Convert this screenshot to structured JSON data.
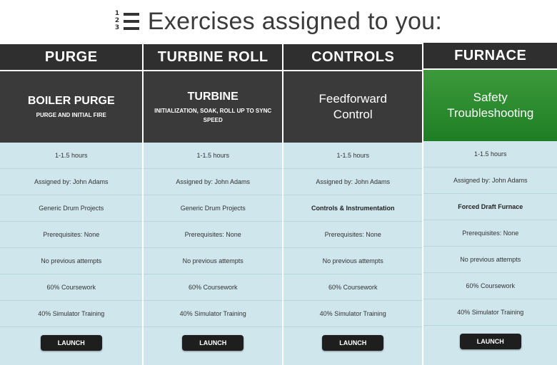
{
  "header": {
    "title": "Exercises assigned to you:",
    "icon": "numbered-list-icon",
    "icon_numbers": [
      "1",
      "2",
      "3"
    ]
  },
  "columns": [
    {
      "heading": "PURGE",
      "feature_title": "BOILER PURGE",
      "feature_subtitle": "PURGE AND INITIAL FIRE",
      "feature_style": "dark",
      "duration": "1-1.5 hours",
      "assigned_by": "Assigned by: John Adams",
      "project": "Generic Drum Projects",
      "prerequisites": "Prerequisites: None",
      "attempts": "No previous attempts",
      "coursework": "60% Coursework",
      "simulator": "40% Simulator Training",
      "launch_label": "LAUNCH"
    },
    {
      "heading": "TURBINE ROLL",
      "feature_title": "TURBINE",
      "feature_subtitle": "INITIALIZATION, SOAK, ROLL UP TO SYNC SPEED",
      "feature_style": "dark",
      "duration": "1-1.5 hours",
      "assigned_by": "Assigned by: John Adams",
      "project": "Generic Drum Projects",
      "prerequisites": "Prerequisites: None",
      "attempts": "No previous attempts",
      "coursework": "60% Coursework",
      "simulator": "40% Simulator Training",
      "launch_label": "LAUNCH"
    },
    {
      "heading": "CONTROLS",
      "feature_title": "Feedforward Control",
      "feature_subtitle": "",
      "feature_style": "dark",
      "duration": "1-1.5 hours",
      "assigned_by": "Assigned by: John Adams",
      "project": "Controls & Instrumentation",
      "prerequisites": "Prerequisites: None",
      "attempts": "No previous attempts",
      "coursework": "60% Coursework",
      "simulator": "40% Simulator Training",
      "launch_label": "LAUNCH"
    },
    {
      "heading": "FURNACE",
      "feature_title": "Safety Troubleshooting",
      "feature_subtitle": "",
      "feature_style": "green",
      "duration": "1-1.5 hours",
      "assigned_by": "Assigned by: John Adams",
      "project": "Forced Draft Furnace",
      "prerequisites": "Prerequisites: None",
      "attempts": "No previous attempts",
      "coursework": "60% Coursework",
      "simulator": "40% Simulator Training",
      "launch_label": "LAUNCH"
    }
  ],
  "colors": {
    "header_bg": "#2f2f2f",
    "feature_dark": "#3a3a3a",
    "feature_green": "#2e8b30",
    "body_bg": "#cfe6ec",
    "button_bg": "#1e1e1e"
  }
}
